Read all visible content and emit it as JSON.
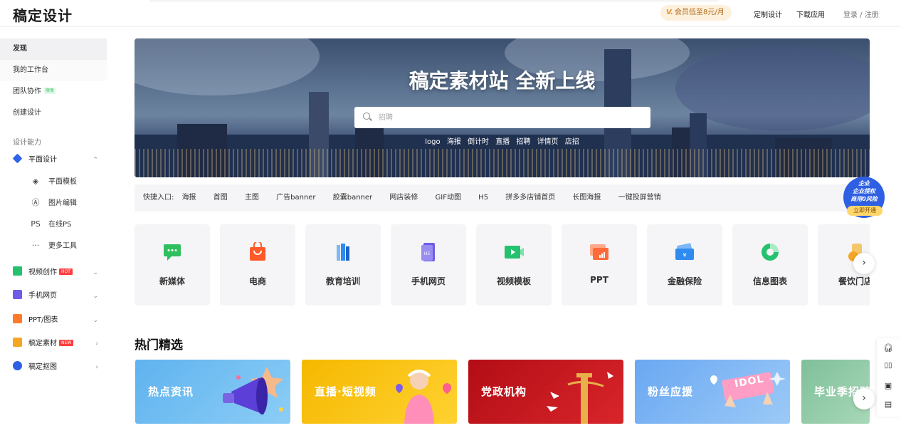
{
  "header": {
    "logo": "稿定设计",
    "member": "会员低至8元/月",
    "links": [
      "定制设计",
      "下载应用"
    ],
    "login": "登录 / 注册"
  },
  "sidebar": {
    "top": [
      "发现",
      "我的工作台",
      "团队协作",
      "创建设计"
    ],
    "team_badge": "限免",
    "section": "设计能力",
    "groups": [
      {
        "label": "平面设计",
        "color": "#2f63e8",
        "icon": "diamond-icon"
      },
      {
        "label": "视频创作",
        "color": "#25c16f",
        "icon": "video-icon",
        "badge": "HOT"
      },
      {
        "label": "手机网页",
        "color": "#6e5de8",
        "icon": "h5-icon"
      },
      {
        "label": "PPT/图表",
        "color": "#ff7a2a",
        "icon": "ppt-icon"
      },
      {
        "label": "稿定素材",
        "color": "#f5a623",
        "icon": "folder-icon",
        "badge": "NEW"
      },
      {
        "label": "稿定抠图",
        "color": "#2f5fe3",
        "icon": "cutout-icon"
      }
    ],
    "sub": [
      {
        "icon": "◈",
        "label": "平面模板"
      },
      {
        "icon": "Ⓐ",
        "label": "图片编辑"
      },
      {
        "icon": "PS",
        "label": "在线PS"
      },
      {
        "icon": "···",
        "label": "更多工具"
      }
    ]
  },
  "banner": {
    "title": "稿定素材站 全新上线",
    "search_placeholder": "招聘",
    "hot_words": [
      "logo",
      "海报",
      "倒计时",
      "直播",
      "招聘",
      "详情页",
      "店招"
    ]
  },
  "quick": {
    "label": "快捷入口:",
    "items": [
      "海报",
      "首图",
      "主图",
      "广告banner",
      "胶囊banner",
      "网店装修",
      "GIF动图",
      "H5",
      "拼多多店铺首页",
      "长图海报",
      "一键投屏营销"
    ]
  },
  "enterprise": {
    "line1": "企业",
    "line2": "企业授权",
    "line3": "商用0风险",
    "cta": "立即开通"
  },
  "categories": [
    {
      "label": "新媒体",
      "color": "#2fbf5f",
      "icon": "chat-icon"
    },
    {
      "label": "电商",
      "color": "#ff5a2a",
      "icon": "shopping-bag-icon"
    },
    {
      "label": "教育培训",
      "color": "#2f8bf0",
      "icon": "books-icon"
    },
    {
      "label": "手机网页",
      "color": "#6e5de8",
      "icon": "phone-icon"
    },
    {
      "label": "视频模板",
      "color": "#25c16f",
      "icon": "video-icon"
    },
    {
      "label": "PPT",
      "color": "#ff6b3a",
      "icon": "ppt-icon"
    },
    {
      "label": "金融保险",
      "color": "#2f8bf0",
      "icon": "card-icon"
    },
    {
      "label": "信息图表",
      "color": "#25c16f",
      "icon": "pie-chart-icon"
    },
    {
      "label": "餐饮门店",
      "color": "#f5a623",
      "icon": "food-icon"
    }
  ],
  "hot": {
    "title": "热门精选",
    "cards": [
      {
        "label": "热点资讯",
        "bg": "#6ab8f0"
      },
      {
        "label": "直播·短视频",
        "bg": "#f7c21b"
      },
      {
        "label": "党政机构",
        "bg": "#c8141c"
      },
      {
        "label": "粉丝应援",
        "bg": "#7ab4f5"
      },
      {
        "label": "毕业季招聘",
        "bg": "#8ec9a8"
      }
    ],
    "idol_text": "IDOL"
  }
}
